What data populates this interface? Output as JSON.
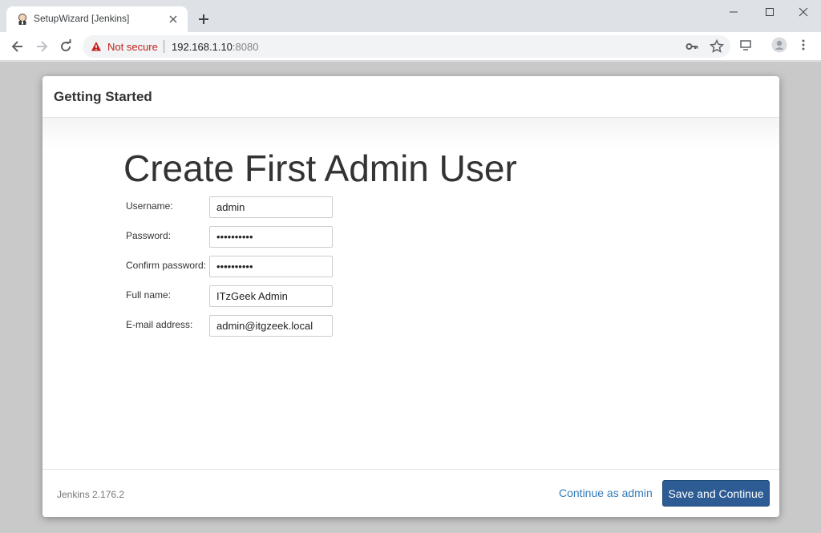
{
  "browser": {
    "tab": {
      "title": "SetupWizard [Jenkins]"
    },
    "address": {
      "security_label": "Not secure",
      "host": "192.168.1.10",
      "port": ":8080"
    },
    "icons": {
      "favicon": "jenkins-butler-icon",
      "close": "close-icon",
      "new_tab": "plus-icon",
      "back": "arrow-left-icon",
      "forward": "arrow-right-icon",
      "reload": "reload-icon",
      "warning": "warning-triangle-icon",
      "key": "key-icon",
      "star": "star-icon",
      "cast": "cast-icon",
      "profile": "profile-icon",
      "menu": "kebab-menu-icon"
    }
  },
  "modal": {
    "header_title": "Getting Started",
    "heading": "Create First Admin User",
    "fields": [
      {
        "label": "Username:",
        "value": "admin",
        "type": "text"
      },
      {
        "label": "Password:",
        "value": "••••••••••",
        "type": "password"
      },
      {
        "label": "Confirm password:",
        "value": "••••••••••",
        "type": "password"
      },
      {
        "label": "Full name:",
        "value": "ITzGeek Admin",
        "type": "text"
      },
      {
        "label": "E-mail address:",
        "value": "admin@itgzeek.local",
        "type": "text"
      }
    ],
    "footer": {
      "version": "Jenkins 2.176.2",
      "continue_label": "Continue as admin",
      "save_label": "Save and Continue"
    }
  },
  "colors": {
    "warning": "#c5221f",
    "primary_button": "#2c5c93",
    "link": "#337ab7"
  }
}
